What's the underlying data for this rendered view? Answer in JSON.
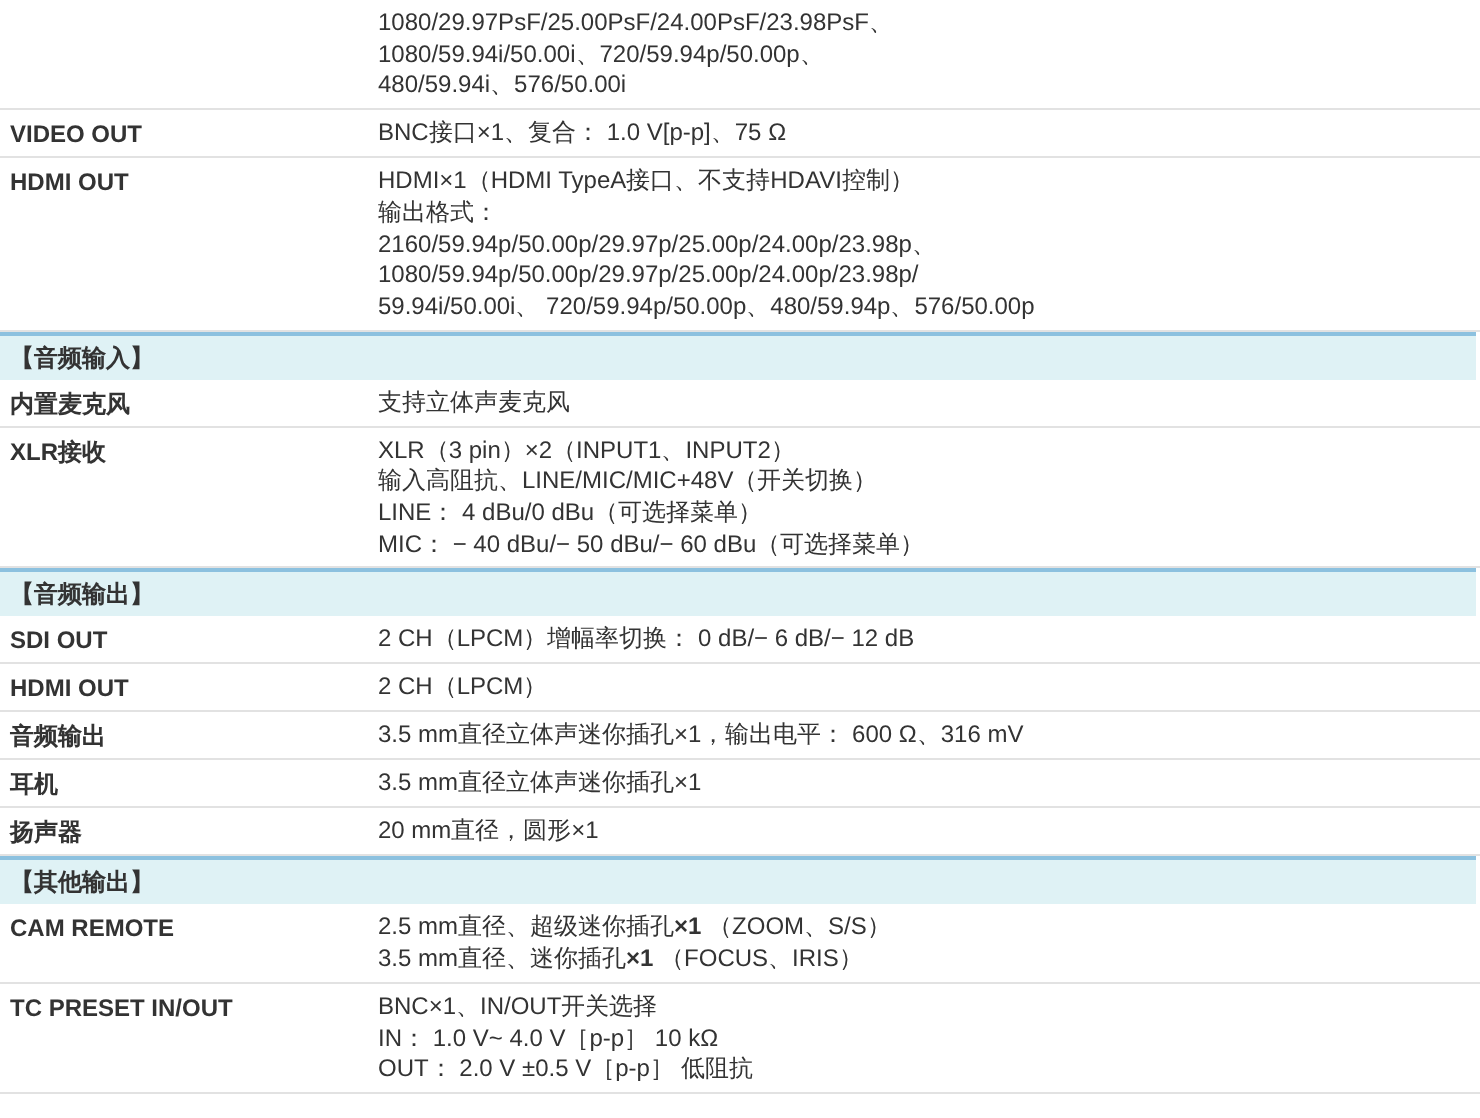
{
  "rows": [
    {
      "kind": "spec",
      "lines": [
        "1080/29.97PsF/25.00PsF/24.00PsF/23.98PsF、",
        "1080/59.94i/50.00i、720/59.94p/50.00p、",
        "480/59.94i、576/50.00i"
      ]
    },
    {
      "kind": "spec",
      "label": "VIDEO OUT",
      "lines": [
        "BNC接口×1、复合： 1.0 V[p-p]、75 Ω"
      ]
    },
    {
      "kind": "spec",
      "label": "HDMI OUT",
      "lines": [
        "HDMI×1（HDMI TypeA接口、不支持HDAVI控制）",
        "输出格式：",
        "2160/59.94p/50.00p/29.97p/25.00p/24.00p/23.98p、",
        "1080/59.94p/50.00p/29.97p/25.00p/24.00p/23.98p/",
        "59.94i/50.00i、 720/59.94p/50.00p、480/59.94p、576/50.00p"
      ]
    },
    {
      "kind": "section",
      "label": "【音频输入】"
    },
    {
      "kind": "spec",
      "label": "内置麦克风",
      "lines": [
        "支持立体声麦克风"
      ]
    },
    {
      "kind": "spec",
      "label": "XLR接收",
      "lines": [
        "XLR（3 pin）×2（INPUT1、INPUT2）",
        "输入高阻抗、LINE/MIC/MIC+48V（开关切换）",
        "LINE： 4 dBu/0 dBu（可选择菜单）",
        "MIC： − 40 dBu/− 50 dBu/− 60 dBu（可选择菜单）"
      ]
    },
    {
      "kind": "section",
      "label": "【音频输出】"
    },
    {
      "kind": "spec",
      "label": "SDI OUT",
      "lines": [
        "2 CH（LPCM）增幅率切换： 0 dB/− 6 dB/− 12 dB"
      ]
    },
    {
      "kind": "spec",
      "label": "HDMI OUT",
      "lines": [
        "2 CH（LPCM）"
      ]
    },
    {
      "kind": "spec",
      "label": "音频输出",
      "lines": [
        "3.5 mm直径立体声迷你插孔×1，输出电平： 600 Ω、316 mV"
      ]
    },
    {
      "kind": "spec",
      "label": "耳机",
      "lines": [
        "3.5 mm直径立体声迷你插孔×1"
      ]
    },
    {
      "kind": "spec",
      "label": "扬声器",
      "lines": [
        "20 mm直径，圆形×1"
      ]
    },
    {
      "kind": "section",
      "label": "【其他输出】"
    },
    {
      "kind": "spec",
      "label": "CAM REMOTE",
      "lines": [
        "2.5 mm直径、超级迷你插孔**×1** （ZOOM、S/S）",
        "3.5 mm直径、迷你插孔**×1** （FOCUS、IRIS）"
      ]
    },
    {
      "kind": "spec",
      "label": "TC PRESET IN/OUT",
      "lines": [
        "BNC×1、IN/OUT开关选择",
        "IN： 1.0 V~ 4.0 V［p-p］ 10 kΩ",
        "OUT： 2.0 V ±0.5 V［p-p］ 低阻抗"
      ]
    }
  ]
}
